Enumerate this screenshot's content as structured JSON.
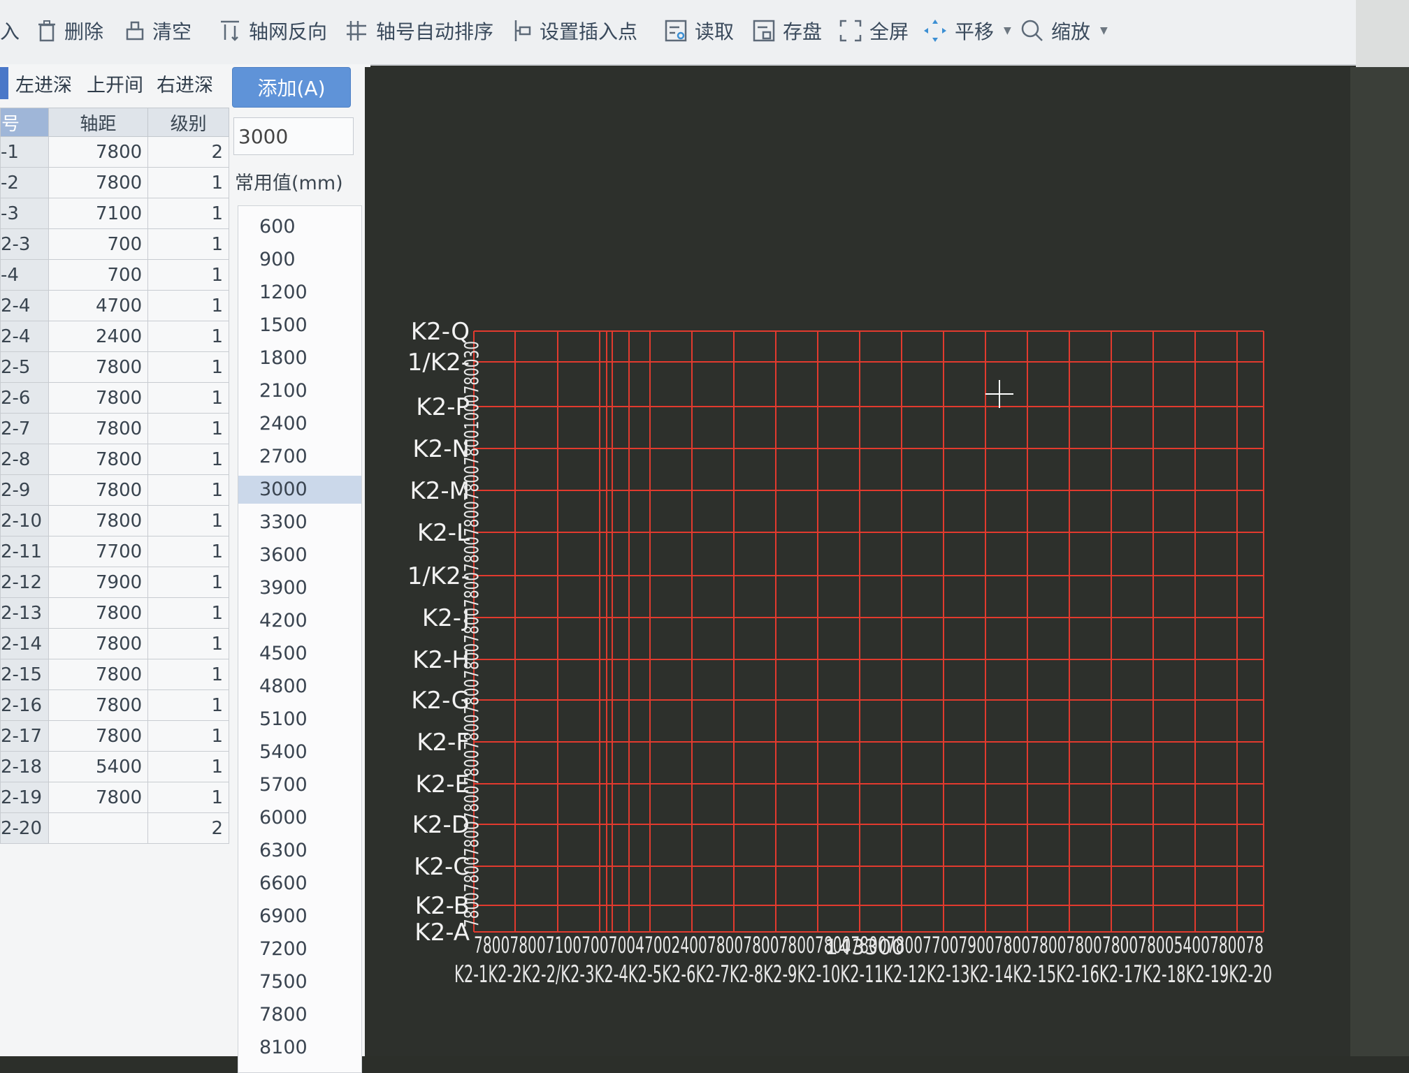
{
  "toolbar": {
    "items": [
      {
        "label": "入",
        "icon": "import-icon"
      },
      {
        "label": "删除",
        "icon": "trash-icon"
      },
      {
        "label": "清空",
        "icon": "eraser-icon"
      },
      {
        "label": "轴网反向",
        "icon": "reverse-axis-icon"
      },
      {
        "label": "轴号自动排序",
        "icon": "sort-axis-icon"
      },
      {
        "label": "设置插入点",
        "icon": "insert-point-icon"
      },
      {
        "label": "读取",
        "icon": "read-file-icon"
      },
      {
        "label": "存盘",
        "icon": "save-file-icon"
      },
      {
        "label": "全屏",
        "icon": "fullscreen-icon"
      },
      {
        "label": "平移",
        "icon": "pan-icon"
      },
      {
        "label": "缩放",
        "icon": "zoom-icon"
      }
    ]
  },
  "tabs": [
    "左进深",
    "上开间",
    "右进深"
  ],
  "add_button": "添加(A)",
  "table": {
    "headers": [
      "号",
      "轴距",
      "级别"
    ],
    "rows": [
      [
        "-1",
        "7800",
        "2"
      ],
      [
        "-2",
        "7800",
        "1"
      ],
      [
        "-3",
        "7100",
        "1"
      ],
      [
        "2-3",
        "700",
        "1"
      ],
      [
        "-4",
        "700",
        "1"
      ],
      [
        "2-4",
        "4700",
        "1"
      ],
      [
        "2-4",
        "2400",
        "1"
      ],
      [
        "2-5",
        "7800",
        "1"
      ],
      [
        "2-6",
        "7800",
        "1"
      ],
      [
        "2-7",
        "7800",
        "1"
      ],
      [
        "2-8",
        "7800",
        "1"
      ],
      [
        "2-9",
        "7800",
        "1"
      ],
      [
        "2-10",
        "7800",
        "1"
      ],
      [
        "2-11",
        "7700",
        "1"
      ],
      [
        "2-12",
        "7900",
        "1"
      ],
      [
        "2-13",
        "7800",
        "1"
      ],
      [
        "2-14",
        "7800",
        "1"
      ],
      [
        "2-15",
        "7800",
        "1"
      ],
      [
        "2-16",
        "7800",
        "1"
      ],
      [
        "2-17",
        "7800",
        "1"
      ],
      [
        "2-18",
        "5400",
        "1"
      ],
      [
        "2-19",
        "7800",
        "1"
      ],
      [
        "2-20",
        "",
        "2"
      ]
    ]
  },
  "value_input": "3000",
  "common_label": "常用值(mm)",
  "common_values": [
    "600",
    "900",
    "1200",
    "1500",
    "1800",
    "2100",
    "2400",
    "2700",
    "3000",
    "3300",
    "3600",
    "3900",
    "4200",
    "4500",
    "4800",
    "5100",
    "5400",
    "5700",
    "6000",
    "6300",
    "6600",
    "6900",
    "7200",
    "7500",
    "7800",
    "8100"
  ],
  "common_selected": "3000",
  "drawing": {
    "left_labels": [
      "K2-Q",
      "1/K2-",
      "K2-P",
      "K2-N",
      "K2-M",
      "K2-L",
      "1/K2-",
      "K2-J",
      "K2-H",
      "K2-G",
      "K2-F",
      "K2-E",
      "K2-D",
      "K2-C",
      "K2-B",
      "K2-A"
    ],
    "left_dims": "780078007800780078007800780078007800780078007800780078001000780030",
    "bottom_dims": "7800780071007007004700240078007800780078007800780077007900780078007800780078005400780078",
    "bottom_total": "143300",
    "bottom_labels": "K2-1K2-2K2-2/K2-3K2-4K2-5K2-6K2-7K2-8K2-9K2-10K2-11K2-12K2-13K2-14K2-15K2-16K2-17K2-18K2-19K2-20"
  },
  "colors": {
    "grid": "#e23a2e",
    "canvas": "#2d302c",
    "selection": "#cbd8ea",
    "accent": "#5f93d8"
  }
}
